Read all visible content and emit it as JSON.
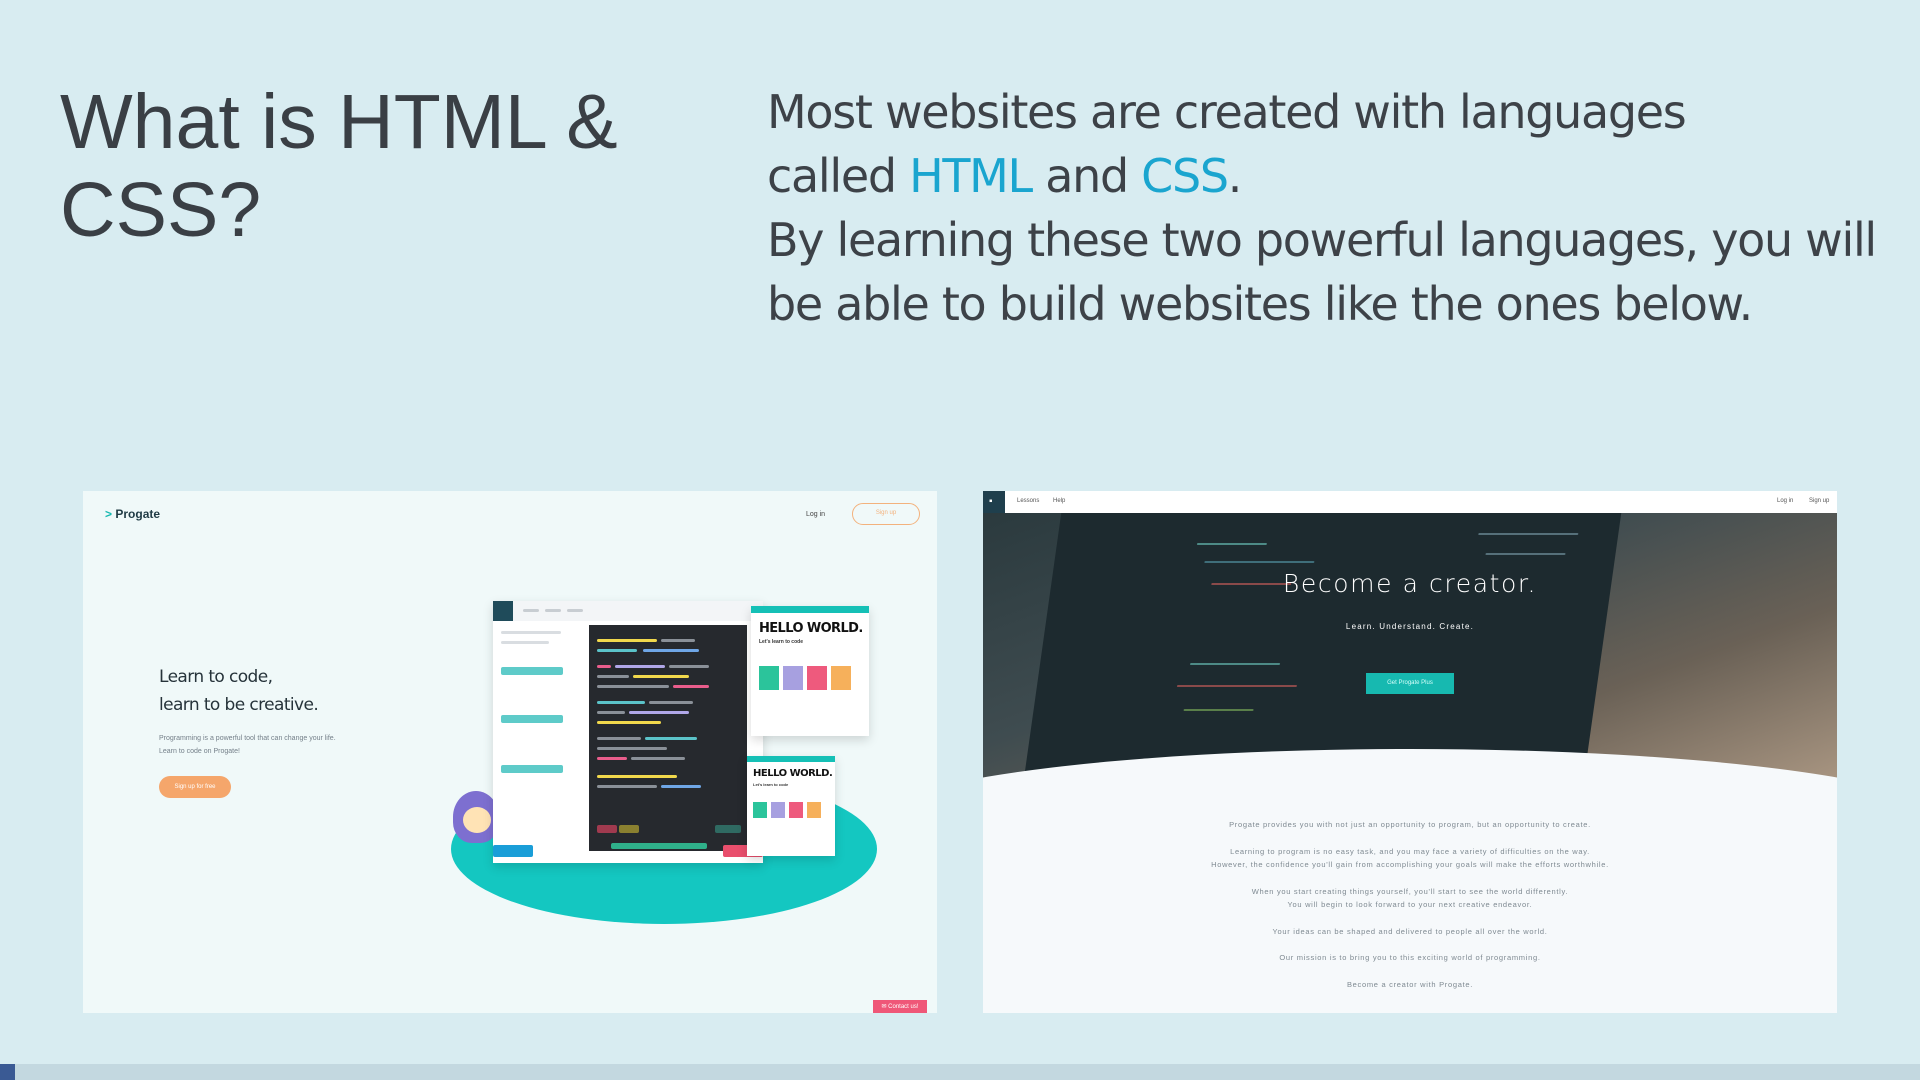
{
  "slide": {
    "title": "What is HTML & CSS?",
    "intro": {
      "line1": "Most websites are created with languages",
      "called": "called ",
      "html": "HTML",
      "and": " and ",
      "css": "CSS",
      "period": ".",
      "line3": "By learning these two powerful languages, you will be able to build websites like the ones below."
    }
  },
  "left_shot": {
    "logo_chevron": ">",
    "logo": "Progate",
    "login": "Log in",
    "signup": "Sign up",
    "headline1": "Learn to code,",
    "headline2": "learn to be creative.",
    "sub1": "Programming is a powerful tool that can change your life.",
    "sub2": "Learn to code on Progate!",
    "cta": "Sign up for free",
    "contact": "✉ Contact us!",
    "preview_title": "HELLO WORLD.",
    "preview_sub": "Let's learn to code"
  },
  "right_shot": {
    "nav_lessons": "Lessons",
    "nav_help": "Help",
    "nav_login": "Log in",
    "nav_signup": "Sign up",
    "headline": "Become a creator.",
    "tagline": "Learn. Understand. Create.",
    "cta": "Get Progate Plus",
    "body": [
      "Progate provides you with not just an opportunity to program, but an opportunity to create.",
      "Learning to program is no easy task, and you may face a variety of difficulties on the way.",
      "However, the confidence you'll gain from accomplishing your goals will make the efforts worthwhile.",
      "When you start creating things yourself, you'll start to see the world differently.",
      "You will begin to look forward to your next creative endeavor.",
      "Your ideas can be shaped and delivered to people all over the world.",
      "Our mission is to bring you to this exciting world of programming.",
      "Become a creator with Progate."
    ]
  },
  "colors": {
    "background": "#d8ecf1",
    "highlight": "#1aa5cf",
    "text": "#3d4248",
    "teal": "#14c7c1",
    "orange": "#f5a66b"
  }
}
